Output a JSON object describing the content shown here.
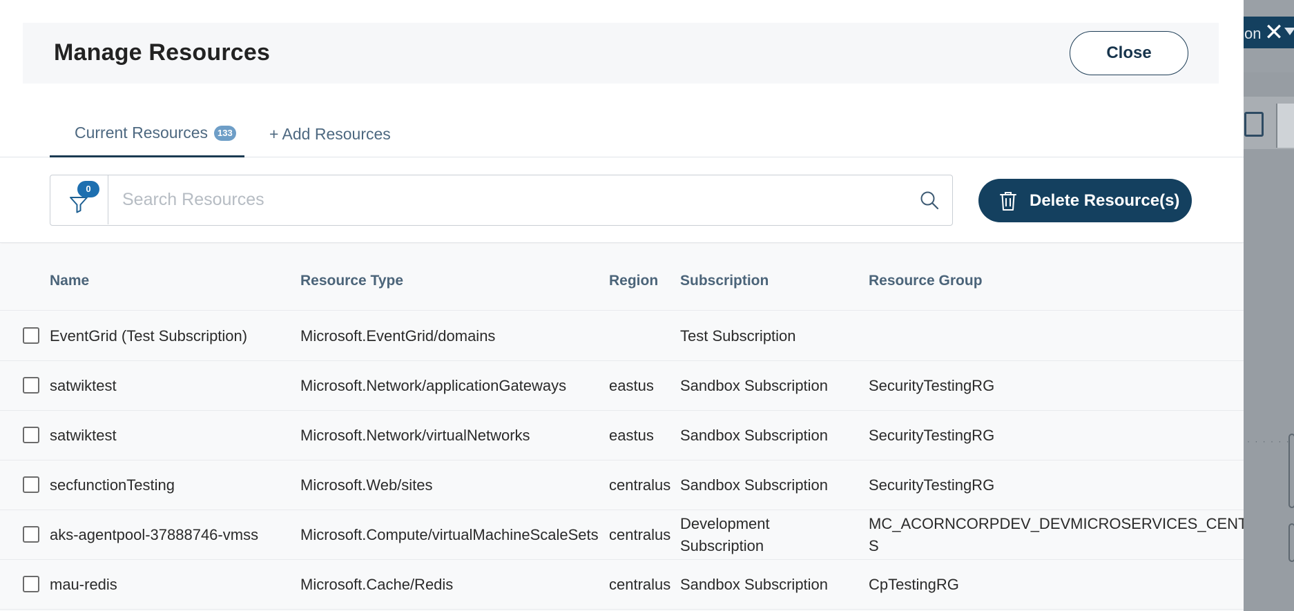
{
  "background": {
    "topbar_text": "on",
    "close_glyph": "✕"
  },
  "modal": {
    "title": "Manage Resources",
    "close_label": "Close"
  },
  "tabs": {
    "current_label": "Current Resources",
    "current_count": "133",
    "add_label": "+ Add Resources"
  },
  "toolbar": {
    "filter_count": "0",
    "search_placeholder": "Search Resources",
    "search_value": "",
    "delete_label": "Delete Resource(s)"
  },
  "table": {
    "headers": {
      "name": "Name",
      "type": "Resource Type",
      "region": "Region",
      "subscription": "Subscription",
      "group": "Resource Group"
    },
    "rows": [
      {
        "name": "EventGrid (Test Subscription)",
        "type": "Microsoft.EventGrid/domains",
        "region": "",
        "subscription": "Test Subscription",
        "group": "",
        "checked": false
      },
      {
        "name": "satwiktest",
        "type": "Microsoft.Network/applicationGateways",
        "region": "eastus",
        "subscription": "Sandbox Subscription",
        "group": "SecurityTestingRG",
        "checked": false
      },
      {
        "name": "satwiktest",
        "type": "Microsoft.Network/virtualNetworks",
        "region": "eastus",
        "subscription": "Sandbox Subscription",
        "group": "SecurityTestingRG",
        "checked": false
      },
      {
        "name": "secfunctionTesting",
        "type": "Microsoft.Web/sites",
        "region": "centralus",
        "subscription": "Sandbox Subscription",
        "group": "SecurityTestingRG",
        "checked": false
      },
      {
        "name": "aks-agentpool-37888746-vmss",
        "type": "Microsoft.Compute/virtualMachineScaleSets",
        "region": "centralus",
        "subscription_lines": [
          "Development",
          "Subscription"
        ],
        "group_lines": [
          "MC_ACORNCORPDEV_DEVMICROSERVICES_CENTRALU",
          "S"
        ],
        "checked": false
      },
      {
        "name": "mau-redis",
        "type": "Microsoft.Cache/Redis",
        "region": "centralus",
        "subscription": "Sandbox Subscription",
        "group": "CpTestingRG",
        "checked": false
      }
    ]
  },
  "colors": {
    "primary": "#14405f",
    "tab_text": "#4d6880",
    "badge": "#6e9ec7",
    "filter_badge": "#1d6fb0"
  }
}
